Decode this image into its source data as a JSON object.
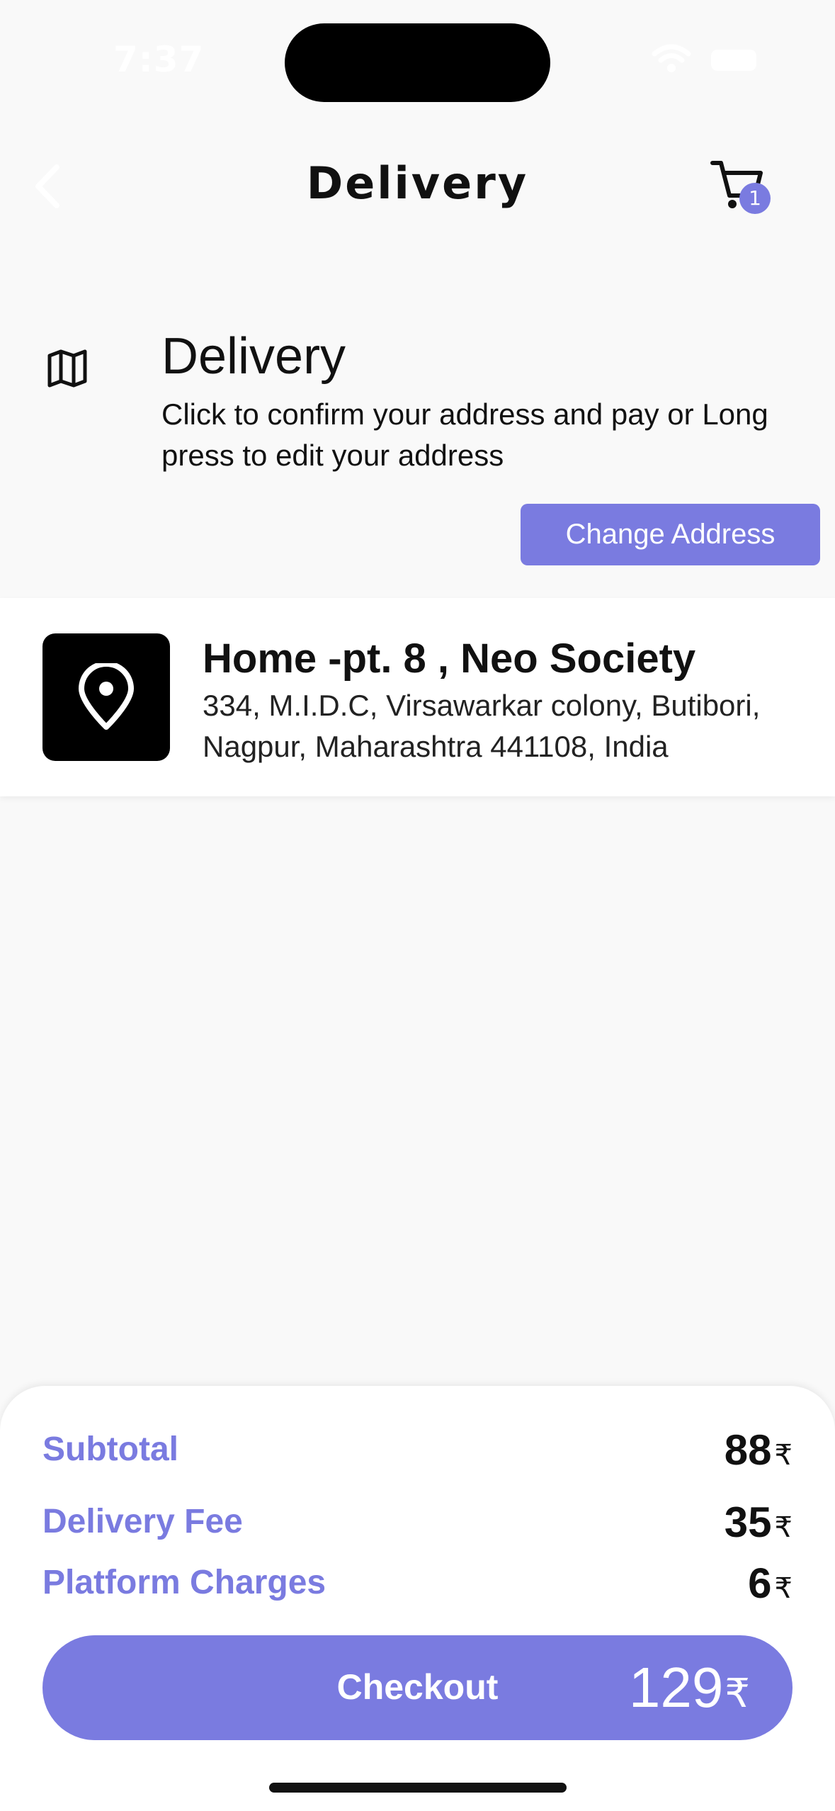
{
  "status_bar": {
    "time": "7:37"
  },
  "nav": {
    "title": "Delivery",
    "cart_count": "1"
  },
  "delivery_section": {
    "title": "Delivery",
    "description": "Click to confirm your address and pay or Long press to edit your address",
    "change_button_label": "Change Address"
  },
  "address": {
    "name": "Home -pt. 8 , Neo Society",
    "line1": "334, M.I.D.C, Virsawarkar colony, Butibori,",
    "line2": "Nagpur, Maharashtra 441108, India"
  },
  "summary": {
    "currency": "₹",
    "rows": [
      {
        "label": "Subtotal",
        "value": "88"
      },
      {
        "label": "Delivery Fee",
        "value": "35"
      },
      {
        "label": "Platform Charges",
        "value": "6"
      }
    ],
    "checkout_label": "Checkout",
    "total": "129"
  },
  "colors": {
    "accent": "#7a7be0",
    "background": "#f9f9f9",
    "text": "#111111"
  },
  "icons": [
    "back-chevron-icon",
    "cart-icon",
    "map-icon",
    "location-pin-icon",
    "wifi-icon",
    "battery-icon"
  ]
}
